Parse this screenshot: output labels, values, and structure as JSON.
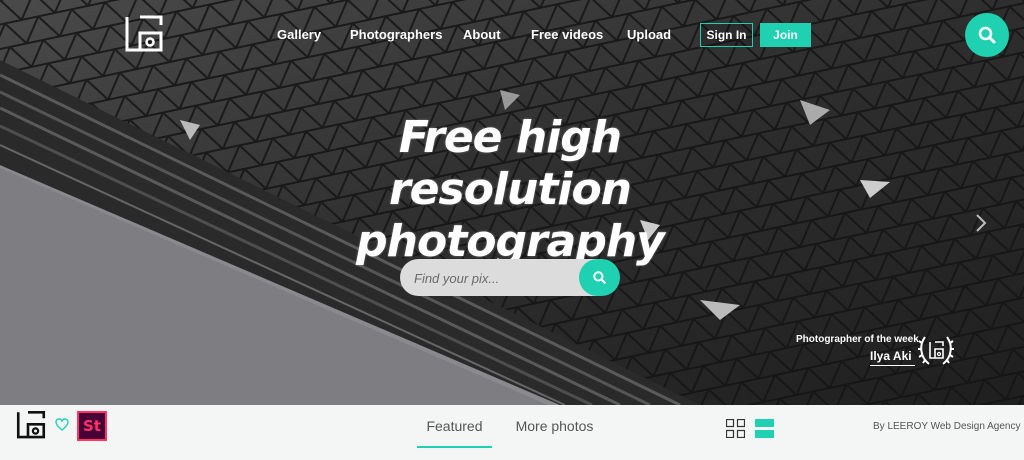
{
  "nav": {
    "items": [
      "Gallery",
      "Photographers",
      "About",
      "Free videos",
      "Upload"
    ],
    "sign_in": "Sign In",
    "join": "Join"
  },
  "hero": {
    "headline": "Free high resolution photography",
    "search_placeholder": "Find your pix...",
    "photographer_label": "Photographer of the week",
    "photographer_name": "Ilya Aki"
  },
  "bottom": {
    "badge_text": "St",
    "tabs": [
      "Featured",
      "More photos"
    ],
    "active_tab": "Featured",
    "credit": "By LEEROY Web Design Agency"
  },
  "icons": {
    "logo": "site-logo-icon",
    "search": "search-icon",
    "next": "chevron-right-icon",
    "laurel": "laurel-badge-icon",
    "heart": "heart-icon",
    "grid_view": "grid-view-icon",
    "list_view": "list-view-icon"
  },
  "colors": {
    "accent": "#1fd1b0",
    "badge_bg": "#470137",
    "badge_fg": "#ff3366",
    "bottombar_bg": "#f4f6f6"
  }
}
